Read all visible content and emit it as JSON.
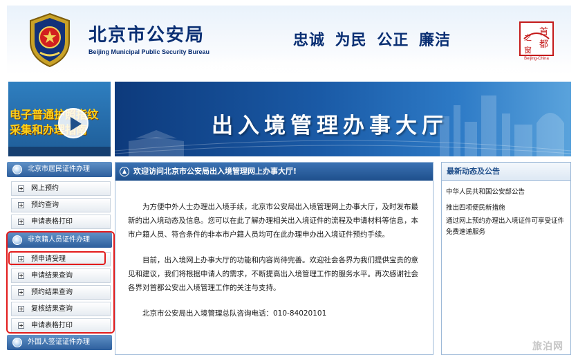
{
  "header": {
    "title": "北京市公安局",
    "subtitle": "Beijing Municipal Public Security Bureau",
    "slogan": "忠诚 为民 公正 廉洁",
    "capital_logo": {
      "chars": [
        "首",
        "都",
        "之",
        "窗"
      ],
      "caption": "Beijing-China"
    }
  },
  "video": {
    "line1": "电子普通护照指纹",
    "line2": "采集和办理指南",
    "icon": "play-icon"
  },
  "banner": {
    "title": "出入境管理办事大厅"
  },
  "sidebar": {
    "sections": [
      {
        "title": "北京市居民证件办理",
        "items": [
          "网上预约",
          "预约查询",
          "申请表格打印"
        ]
      },
      {
        "title": "非京籍人员证件办理",
        "items": [
          "预申请受理",
          "申请结果查询",
          "预约结果查询",
          "复核结果查询",
          "申请表格打印"
        ]
      },
      {
        "title": "外国人签证证件办理",
        "items": []
      }
    ],
    "highlight_color": "#e21b1b"
  },
  "main": {
    "heading": "欢迎访问北京市公安局出入境管理网上办事大厅!",
    "paragraphs": [
      "为方便中外人士办理出入境手续，北京市公安局出入境管理网上办事大厅，及时发布最新的出入境动态及信息。您可以在此了解办理相关出入境证件的流程及申请材料等信息，本市户籍人员、符合条件的非本市户籍人员均可在此办理申办出入境证件预约手续。",
      "目前，出入境网上办事大厅的功能和内容尚待完善。欢迎社会各界为我们提供宝贵的意见和建议，我们将根据申请人的需求，不断提高出入境管理工作的服务水平。再次感谢社会各界对首都公安出入境管理工作的关注与支持。"
    ],
    "hotline": "北京市公安局出入境管理总队咨询电话：010-84020101"
  },
  "news": {
    "heading": "最新动态及公告",
    "items": [
      "中华人民共和国公安部公告",
      "推出四项便民新措施",
      "通过网上预约办理出入境证件可享受证件免费速递服务"
    ]
  },
  "watermark": "旅泊网",
  "colors": {
    "brand_navy": "#0a2f73",
    "header_blue": "#1e4f8c",
    "highlight_red": "#e21b1b",
    "gold_text": "#ffd21a"
  }
}
